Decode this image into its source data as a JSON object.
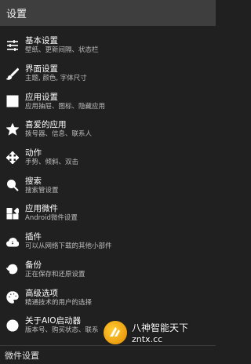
{
  "app_bar": {
    "title": "设置"
  },
  "items": [
    {
      "icon": "sliders-icon",
      "title": "基本设置",
      "subtitle": "壁纸、更新间隔、状态栏"
    },
    {
      "icon": "brush-icon",
      "title": "界面设置",
      "subtitle": "主题, 颜色, 字体尺寸"
    },
    {
      "icon": "grid-icon",
      "title": "应用设置",
      "subtitle": "应用抽屉、图标、隐藏应用"
    },
    {
      "icon": "star-icon",
      "title": "喜爱的应用",
      "subtitle": "拨号器、信息、联系人"
    },
    {
      "icon": "move-arrows-icon",
      "title": "动作",
      "subtitle": "手势、倾斜、双击"
    },
    {
      "icon": "search-icon",
      "title": "搜索",
      "subtitle": "搜索管设置"
    },
    {
      "icon": "widgets-icon",
      "title": "应用微件",
      "subtitle": "Android微件设置"
    },
    {
      "icon": "cloud-download-icon",
      "title": "插件",
      "subtitle": "可以从网络下载的其他小部件"
    },
    {
      "icon": "restore-icon",
      "title": "备份",
      "subtitle": "正在保存和还原设置"
    },
    {
      "icon": "palette-icon",
      "title": "高级选项",
      "subtitle": "精通技术的用户的选择"
    },
    {
      "icon": "info-icon",
      "title": "关于AIO启动器",
      "subtitle": "版本号、购买状态、联系"
    }
  ],
  "section_header": "微件设置",
  "watermark": {
    "name": "八神智能天下",
    "url": "zntx.cc"
  }
}
